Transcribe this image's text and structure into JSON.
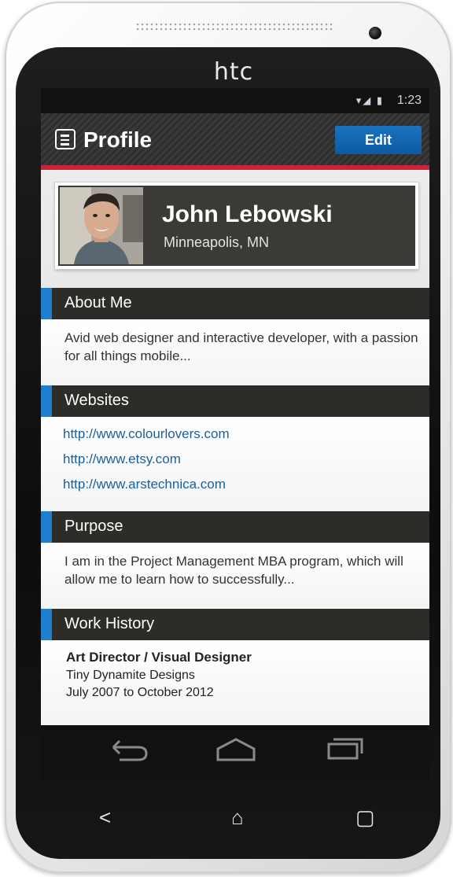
{
  "device": {
    "brand": "htc"
  },
  "status_bar": {
    "icons": "▾◢ ▮",
    "time": "1:23"
  },
  "header": {
    "title": "Profile",
    "edit_label": "Edit"
  },
  "profile": {
    "name": "John Lebowski",
    "location": "Minneapolis, MN"
  },
  "sections": {
    "about": {
      "title": "About Me",
      "text": "Avid web designer and interactive developer, with a passion for all things mobile..."
    },
    "websites": {
      "title": "Websites",
      "links": [
        "http://www.colourlovers.com",
        "http://www.etsy.com",
        "http://www.arstechnica.com"
      ]
    },
    "purpose": {
      "title": "Purpose",
      "text": "I am in the Project Management MBA program, which will allow me to learn how to successfully..."
    },
    "work": {
      "title": "Work History",
      "job_title": "Art Director / Visual Designer",
      "company": "Tiny Dynamite Designs",
      "dates": "July 2007 to October 2012"
    }
  },
  "softkeys": {
    "back": "⟵",
    "home": "⌂",
    "recent": "▭"
  },
  "hardware_keys": {
    "back": "<",
    "home": "⌂",
    "recent": "▢"
  },
  "colors": {
    "accent_blue": "#1f7fcf",
    "header_red": "#c9223b",
    "edit_blue": "#0d5aa0",
    "section_dark": "#2e2c29",
    "link": "#1b5f9a"
  }
}
